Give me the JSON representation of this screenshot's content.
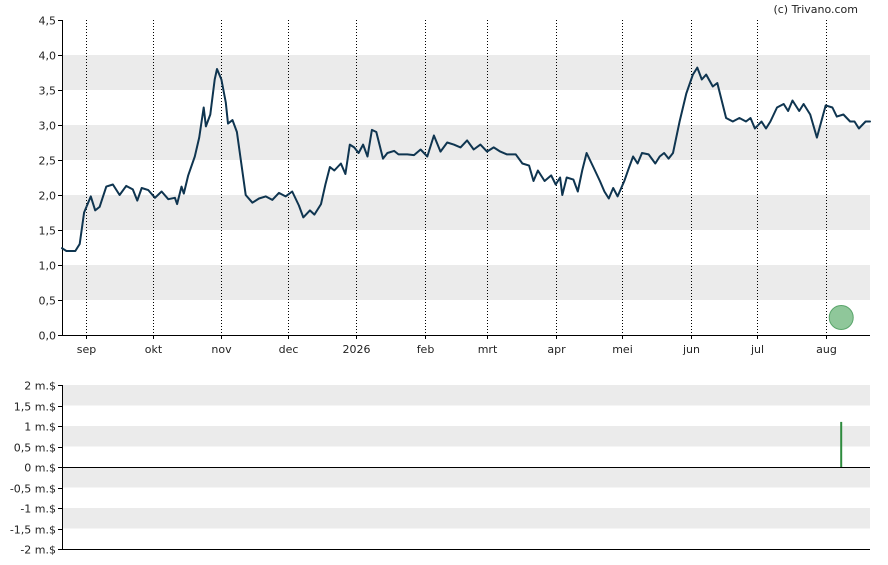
{
  "credit": "(c) Trivano.com",
  "colors": {
    "background": "#ffffff",
    "band": "#ebebeb",
    "line": "#0f3550",
    "marker_fill": "#8fc79a",
    "marker_stroke": "#5aa56b",
    "volume_bar": "#2e8b3e",
    "axis": "#000000",
    "month_grid": "#000000"
  },
  "chart_data": [
    {
      "type": "line",
      "title": "",
      "xlabel": "",
      "ylabel": "",
      "ylim": [
        0,
        4.5
      ],
      "yticks": [
        0,
        0.5,
        1.0,
        1.5,
        2.0,
        2.5,
        3.0,
        3.5,
        4.0,
        4.5
      ],
      "ytick_labels": [
        "0,0",
        "0,5",
        "1,0",
        "1,5",
        "2,0",
        "2,5",
        "3,0",
        "3,5",
        "4,0",
        "4,5"
      ],
      "xlim": [
        "2025-08-21",
        "2026-08-21"
      ],
      "month_ticks": [
        {
          "date": "2025-09-01",
          "label": "sep"
        },
        {
          "date": "2025-10-01",
          "label": "okt"
        },
        {
          "date": "2025-11-01",
          "label": "nov"
        },
        {
          "date": "2025-12-01",
          "label": "dec"
        },
        {
          "date": "2026-01-01",
          "label": "2026"
        },
        {
          "date": "2026-02-01",
          "label": "feb"
        },
        {
          "date": "2026-03-01",
          "label": "mrt"
        },
        {
          "date": "2026-04-01",
          "label": "apr"
        },
        {
          "date": "2026-05-01",
          "label": "mei"
        },
        {
          "date": "2026-06-01",
          "label": "jun"
        },
        {
          "date": "2026-07-01",
          "label": "jul"
        },
        {
          "date": "2026-08-01",
          "label": "aug"
        }
      ],
      "grid": "alternating horizontal bands, dotted vertical month lines",
      "series": [
        {
          "points": [
            [
              "2025-08-21",
              1.24
            ],
            [
              "2025-08-23",
              1.2
            ],
            [
              "2025-08-27",
              1.2
            ],
            [
              "2025-08-29",
              1.3
            ],
            [
              "2025-08-31",
              1.75
            ],
            [
              "2025-09-03",
              1.98
            ],
            [
              "2025-09-05",
              1.78
            ],
            [
              "2025-09-07",
              1.83
            ],
            [
              "2025-09-10",
              2.12
            ],
            [
              "2025-09-13",
              2.15
            ],
            [
              "2025-09-16",
              2.0
            ],
            [
              "2025-09-19",
              2.13
            ],
            [
              "2025-09-22",
              2.08
            ],
            [
              "2025-09-24",
              1.92
            ],
            [
              "2025-09-26",
              2.1
            ],
            [
              "2025-09-29",
              2.07
            ],
            [
              "2025-10-02",
              1.96
            ],
            [
              "2025-10-05",
              2.05
            ],
            [
              "2025-10-08",
              1.94
            ],
            [
              "2025-10-11",
              1.96
            ],
            [
              "2025-10-12",
              1.87
            ],
            [
              "2025-10-14",
              2.12
            ],
            [
              "2025-10-15",
              2.02
            ],
            [
              "2025-10-17",
              2.28
            ],
            [
              "2025-10-20",
              2.55
            ],
            [
              "2025-10-22",
              2.82
            ],
            [
              "2025-10-24",
              3.25
            ],
            [
              "2025-10-25",
              2.98
            ],
            [
              "2025-10-27",
              3.15
            ],
            [
              "2025-10-29",
              3.65
            ],
            [
              "2025-10-30",
              3.8
            ],
            [
              "2025-11-01",
              3.65
            ],
            [
              "2025-11-03",
              3.32
            ],
            [
              "2025-11-04",
              3.02
            ],
            [
              "2025-11-06",
              3.07
            ],
            [
              "2025-11-08",
              2.9
            ],
            [
              "2025-11-10",
              2.45
            ],
            [
              "2025-11-12",
              2.0
            ],
            [
              "2025-11-15",
              1.89
            ],
            [
              "2025-11-18",
              1.95
            ],
            [
              "2025-11-21",
              1.98
            ],
            [
              "2025-11-24",
              1.93
            ],
            [
              "2025-11-27",
              2.03
            ],
            [
              "2025-11-30",
              1.98
            ],
            [
              "2025-12-03",
              2.05
            ],
            [
              "2025-12-06",
              1.85
            ],
            [
              "2025-12-08",
              1.68
            ],
            [
              "2025-12-11",
              1.78
            ],
            [
              "2025-12-13",
              1.72
            ],
            [
              "2025-12-16",
              1.87
            ],
            [
              "2025-12-18",
              2.15
            ],
            [
              "2025-12-20",
              2.4
            ],
            [
              "2025-12-22",
              2.35
            ],
            [
              "2025-12-25",
              2.45
            ],
            [
              "2025-12-27",
              2.3
            ],
            [
              "2025-12-29",
              2.72
            ],
            [
              "2025-12-31",
              2.68
            ],
            [
              "2026-01-02",
              2.6
            ],
            [
              "2026-01-04",
              2.72
            ],
            [
              "2026-01-06",
              2.55
            ],
            [
              "2026-01-08",
              2.93
            ],
            [
              "2026-01-10",
              2.9
            ],
            [
              "2026-01-13",
              2.52
            ],
            [
              "2026-01-15",
              2.6
            ],
            [
              "2026-01-18",
              2.63
            ],
            [
              "2026-01-20",
              2.58
            ],
            [
              "2026-01-24",
              2.58
            ],
            [
              "2026-01-27",
              2.57
            ],
            [
              "2026-01-30",
              2.65
            ],
            [
              "2026-02-02",
              2.55
            ],
            [
              "2026-02-05",
              2.85
            ],
            [
              "2026-02-08",
              2.62
            ],
            [
              "2026-02-11",
              2.75
            ],
            [
              "2026-02-14",
              2.72
            ],
            [
              "2026-02-17",
              2.68
            ],
            [
              "2026-02-20",
              2.78
            ],
            [
              "2026-02-23",
              2.65
            ],
            [
              "2026-02-26",
              2.72
            ],
            [
              "2026-03-01",
              2.62
            ],
            [
              "2026-03-04",
              2.68
            ],
            [
              "2026-03-07",
              2.62
            ],
            [
              "2026-03-10",
              2.58
            ],
            [
              "2026-03-14",
              2.58
            ],
            [
              "2026-03-17",
              2.45
            ],
            [
              "2026-03-20",
              2.42
            ],
            [
              "2026-03-22",
              2.2
            ],
            [
              "2026-03-24",
              2.35
            ],
            [
              "2026-03-27",
              2.2
            ],
            [
              "2026-03-30",
              2.28
            ],
            [
              "2026-04-01",
              2.15
            ],
            [
              "2026-04-03",
              2.25
            ],
            [
              "2026-04-04",
              2.0
            ],
            [
              "2026-04-06",
              2.25
            ],
            [
              "2026-04-09",
              2.22
            ],
            [
              "2026-04-11",
              2.05
            ],
            [
              "2026-04-13",
              2.35
            ],
            [
              "2026-04-15",
              2.6
            ],
            [
              "2026-04-18",
              2.4
            ],
            [
              "2026-04-21",
              2.2
            ],
            [
              "2026-04-23",
              2.05
            ],
            [
              "2026-04-25",
              1.95
            ],
            [
              "2026-04-27",
              2.1
            ],
            [
              "2026-04-29",
              1.98
            ],
            [
              "2026-05-02",
              2.2
            ],
            [
              "2026-05-04",
              2.38
            ],
            [
              "2026-05-06",
              2.55
            ],
            [
              "2026-05-08",
              2.45
            ],
            [
              "2026-05-10",
              2.6
            ],
            [
              "2026-05-13",
              2.58
            ],
            [
              "2026-05-16",
              2.45
            ],
            [
              "2026-05-18",
              2.55
            ],
            [
              "2026-05-20",
              2.6
            ],
            [
              "2026-05-22",
              2.52
            ],
            [
              "2026-05-24",
              2.6
            ],
            [
              "2026-05-27",
              3.05
            ],
            [
              "2026-05-30",
              3.45
            ],
            [
              "2026-06-02",
              3.72
            ],
            [
              "2026-06-04",
              3.82
            ],
            [
              "2026-06-06",
              3.65
            ],
            [
              "2026-06-08",
              3.72
            ],
            [
              "2026-06-11",
              3.55
            ],
            [
              "2026-06-13",
              3.6
            ],
            [
              "2026-06-15",
              3.35
            ],
            [
              "2026-06-17",
              3.1
            ],
            [
              "2026-06-20",
              3.05
            ],
            [
              "2026-06-23",
              3.1
            ],
            [
              "2026-06-26",
              3.05
            ],
            [
              "2026-06-28",
              3.1
            ],
            [
              "2026-06-30",
              2.95
            ],
            [
              "2026-07-03",
              3.05
            ],
            [
              "2026-07-05",
              2.95
            ],
            [
              "2026-07-07",
              3.05
            ],
            [
              "2026-07-10",
              3.25
            ],
            [
              "2026-07-13",
              3.3
            ],
            [
              "2026-07-15",
              3.2
            ],
            [
              "2026-07-17",
              3.35
            ],
            [
              "2026-07-20",
              3.2
            ],
            [
              "2026-07-22",
              3.3
            ],
            [
              "2026-07-25",
              3.15
            ],
            [
              "2026-07-28",
              2.82
            ],
            [
              "2026-07-30",
              3.05
            ],
            [
              "2026-08-01",
              3.28
            ],
            [
              "2026-08-04",
              3.25
            ],
            [
              "2026-08-06",
              3.12
            ],
            [
              "2026-08-09",
              3.15
            ],
            [
              "2026-08-12",
              3.05
            ],
            [
              "2026-08-14",
              3.05
            ],
            [
              "2026-08-16",
              2.95
            ],
            [
              "2026-08-19",
              3.05
            ],
            [
              "2026-08-21",
              3.05
            ]
          ]
        }
      ],
      "marker": {
        "date": "2026-08-08",
        "value": 0.25
      }
    },
    {
      "type": "bar",
      "title": "",
      "xlabel": "",
      "ylabel": "",
      "ylim": [
        -2,
        2
      ],
      "yticks": [
        2,
        1.5,
        1,
        0.5,
        0,
        -0.5,
        -1,
        -1.5,
        -2
      ],
      "ytick_labels": [
        "2 m.$",
        "1,5 m.$",
        "1 m.$",
        "0,5 m.$",
        "0 m.$",
        "-0,5 m.$",
        "-1 m.$",
        "-1,5 m.$",
        "-2 m.$"
      ],
      "grid": "alternating horizontal bands",
      "bars": [
        {
          "date": "2026-08-08",
          "value": 1.1
        }
      ]
    }
  ]
}
